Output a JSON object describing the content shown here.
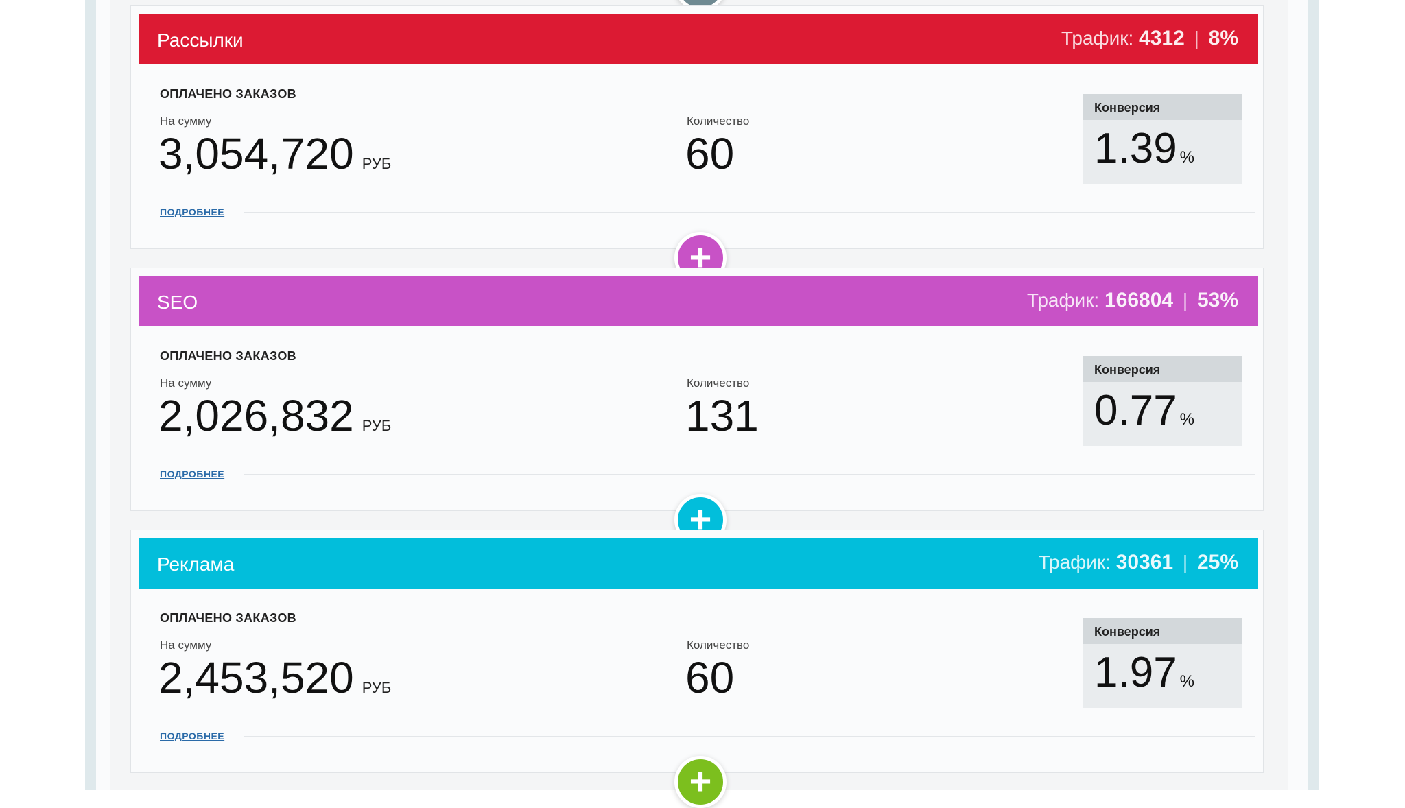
{
  "colors": {
    "mailing": "#dc1a33",
    "seo": "#c852c6",
    "ads": "#02bedb",
    "green": "#7cbf1e",
    "top_button": "#6f8a92"
  },
  "channels": [
    {
      "name": "Рассылки",
      "traffic_label": "Трафик:",
      "traffic_value": "4312",
      "traffic_sep": "|",
      "traffic_pct": "8%",
      "orders_title": "ОПЛАЧЕНО ЗАКАЗОВ",
      "sum_label": "На сумму",
      "sum_value": "3,054,720",
      "currency": "РУБ",
      "qty_label": "Количество",
      "qty_value": "60",
      "conv_label": "Конверсия",
      "conv_value": "1.39",
      "conv_unit": "%",
      "more_label": "ПОДРОБНЕЕ"
    },
    {
      "name": "SEO",
      "traffic_label": "Трафик:",
      "traffic_value": "166804",
      "traffic_sep": "|",
      "traffic_pct": "53%",
      "orders_title": "ОПЛАЧЕНО ЗАКАЗОВ",
      "sum_label": "На сумму",
      "sum_value": "2,026,832",
      "currency": "РУБ",
      "qty_label": "Количество",
      "qty_value": "131",
      "conv_label": "Конверсия",
      "conv_value": "0.77",
      "conv_unit": "%",
      "more_label": "ПОДРОБНЕЕ"
    },
    {
      "name": "Реклама",
      "traffic_label": "Трафик:",
      "traffic_value": "30361",
      "traffic_sep": "|",
      "traffic_pct": "25%",
      "orders_title": "ОПЛАЧЕНО ЗАКАЗОВ",
      "sum_label": "На сумму",
      "sum_value": "2,453,520",
      "currency": "РУБ",
      "qty_label": "Количество",
      "qty_value": "60",
      "conv_label": "Конверсия",
      "conv_value": "1.97",
      "conv_unit": "%",
      "more_label": "ПОДРОБНЕЕ"
    }
  ],
  "plus_buttons": [
    {
      "icon": "plus-icon",
      "glyph": "+"
    },
    {
      "icon": "plus-icon",
      "glyph": "+"
    },
    {
      "icon": "plus-icon",
      "glyph": "+"
    }
  ]
}
